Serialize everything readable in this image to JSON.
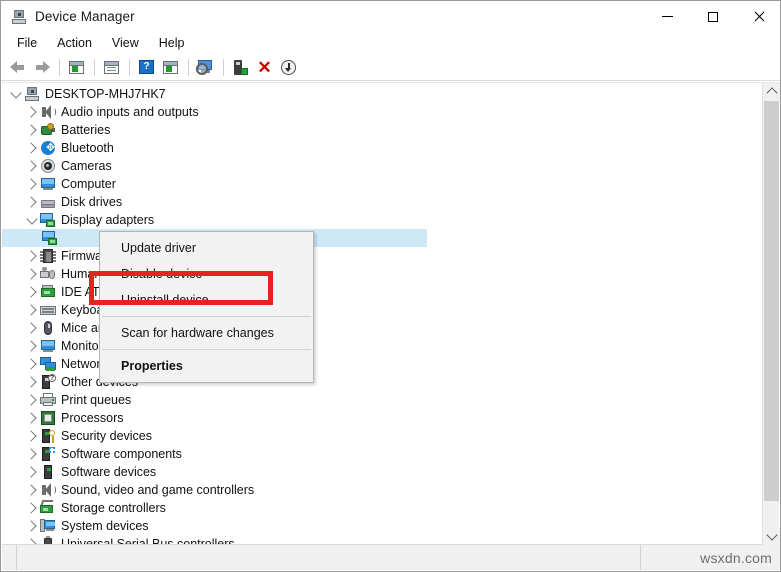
{
  "window": {
    "title": "Device Manager",
    "title_icon": "device-manager-icon",
    "minimize_label": "Minimize",
    "maximize_label": "Maximize",
    "close_label": "Close"
  },
  "menubar": {
    "items": [
      {
        "label": "File"
      },
      {
        "label": "Action"
      },
      {
        "label": "View"
      },
      {
        "label": "Help"
      }
    ]
  },
  "toolbar": {
    "buttons": [
      {
        "name": "back-arrow-icon",
        "tooltip": "Back"
      },
      {
        "name": "forward-arrow-icon",
        "tooltip": "Forward"
      },
      {
        "name": "show-hide-console-tree-icon",
        "tooltip": "Show/Hide Console Tree"
      },
      {
        "name": "properties-icon",
        "tooltip": "Properties"
      },
      {
        "name": "help-icon",
        "tooltip": "Help"
      },
      {
        "name": "update-driver-icon",
        "tooltip": "Update driver"
      },
      {
        "name": "scan-for-hardware-changes-icon",
        "tooltip": "Scan for hardware changes"
      },
      {
        "name": "enable-device-icon",
        "tooltip": "Enable device"
      },
      {
        "name": "uninstall-device-icon",
        "tooltip": "Uninstall device"
      },
      {
        "name": "disable-device-icon",
        "tooltip": "Disable device"
      }
    ]
  },
  "tree": {
    "root": {
      "label": "DESKTOP-MHJ7HK7",
      "icon": "computer-root-icon",
      "expanded": true
    },
    "items": [
      {
        "label": "Audio inputs and outputs",
        "icon": "speaker-icon",
        "expanded": false
      },
      {
        "label": "Batteries",
        "icon": "battery-icon",
        "expanded": false
      },
      {
        "label": "Bluetooth",
        "icon": "bluetooth-icon",
        "expanded": false
      },
      {
        "label": "Cameras",
        "icon": "camera-icon",
        "expanded": false
      },
      {
        "label": "Computer",
        "icon": "monitor-icon",
        "expanded": false
      },
      {
        "label": "Disk drives",
        "icon": "disk-drive-icon",
        "expanded": false
      },
      {
        "label": "Display adapters",
        "icon": "display-adapter-icon",
        "expanded": true
      },
      {
        "label": "",
        "icon": "display-adapter-child-icon",
        "child": true,
        "selected": true
      },
      {
        "label": "Firmware",
        "icon": "firmware-icon",
        "expanded": false
      },
      {
        "label": "Human Interface Devices",
        "icon": "hid-icon",
        "expanded": false
      },
      {
        "label": "IDE ATA/ATAPI controllers",
        "icon": "ide-controller-icon",
        "expanded": false
      },
      {
        "label": "Keyboards",
        "icon": "keyboard-icon",
        "expanded": false
      },
      {
        "label": "Mice and other pointing devices",
        "icon": "mouse-icon",
        "expanded": false
      },
      {
        "label": "Monitors",
        "icon": "monitor-icon",
        "expanded": false
      },
      {
        "label": "Network adapters",
        "icon": "network-adapter-icon",
        "expanded": false
      },
      {
        "label": "Other devices",
        "icon": "other-device-icon",
        "expanded": false
      },
      {
        "label": "Print queues",
        "icon": "printer-icon",
        "expanded": false
      },
      {
        "label": "Processors",
        "icon": "processor-icon",
        "expanded": false
      },
      {
        "label": "Security devices",
        "icon": "security-device-icon",
        "expanded": false
      },
      {
        "label": "Software components",
        "icon": "software-component-icon",
        "expanded": false
      },
      {
        "label": "Software devices",
        "icon": "software-device-icon",
        "expanded": false
      },
      {
        "label": "Sound, video and game controllers",
        "icon": "speaker-icon",
        "expanded": false
      },
      {
        "label": "Storage controllers",
        "icon": "storage-controller-icon",
        "expanded": false
      },
      {
        "label": "System devices",
        "icon": "system-device-icon",
        "expanded": false
      },
      {
        "label": "Universal Serial Bus controllers",
        "icon": "usb-controller-icon",
        "expanded": false
      }
    ]
  },
  "context_menu": {
    "items": [
      {
        "label": "Update driver",
        "bold": false,
        "separator_after": false
      },
      {
        "label": "Disable device",
        "bold": false,
        "separator_after": false
      },
      {
        "label": "Uninstall device",
        "bold": false,
        "separator_after": true
      },
      {
        "label": "Scan for hardware changes",
        "bold": false,
        "separator_after": true
      },
      {
        "label": "Properties",
        "bold": true,
        "separator_after": false
      }
    ],
    "highlight_color": "#e8231f",
    "highlighted_item": "Uninstall device"
  },
  "scrollbar": {
    "up_arrow": "scroll-up-arrow-icon",
    "down_arrow": "scroll-down-arrow-icon"
  },
  "statusbar": {
    "left_text": "",
    "middle_text": "",
    "watermark": "wsxdn.com"
  }
}
